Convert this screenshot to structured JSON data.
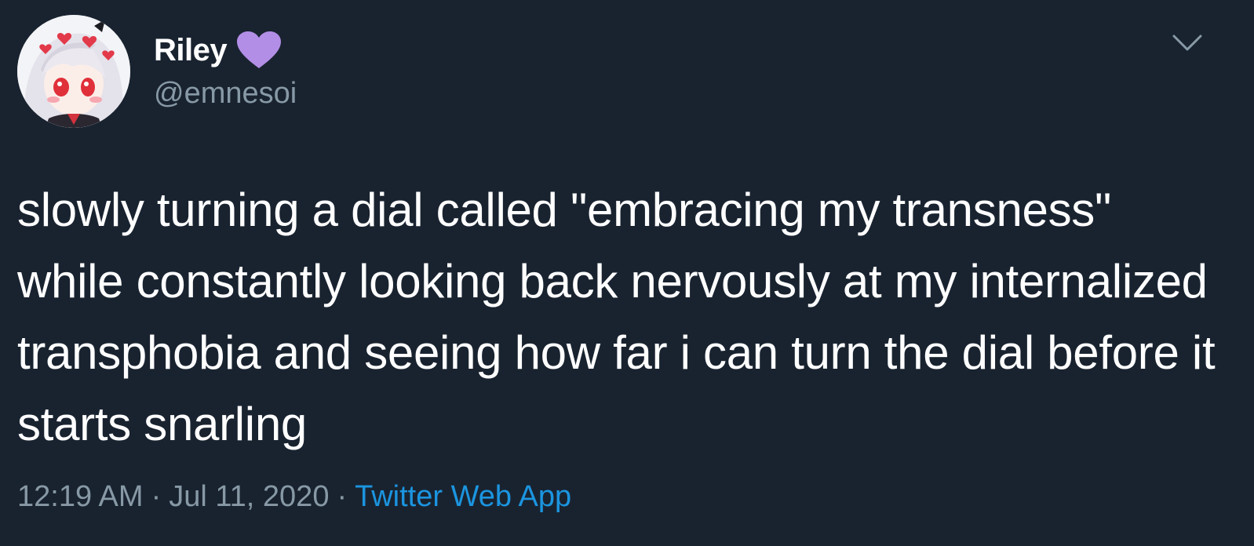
{
  "tweet": {
    "author": {
      "display_name": "Riley",
      "handle": "@emnesoi",
      "badge_icon": "purple-heart-icon",
      "badge_color": "#b38ee6"
    },
    "menu_icon": "chevron-down-icon",
    "text": "slowly turning a dial called \"embracing my transness\" while constantly looking back nervously at my internalized transphobia and seeing how far i can turn the dial before it starts snarling",
    "time": "12:19 AM",
    "separator": "·",
    "date": "Jul 11, 2020",
    "source": "Twitter Web App"
  },
  "colors": {
    "background": "#192330",
    "text_primary": "#ffffff",
    "text_secondary": "#8899a6",
    "link": "#1b95e0"
  }
}
